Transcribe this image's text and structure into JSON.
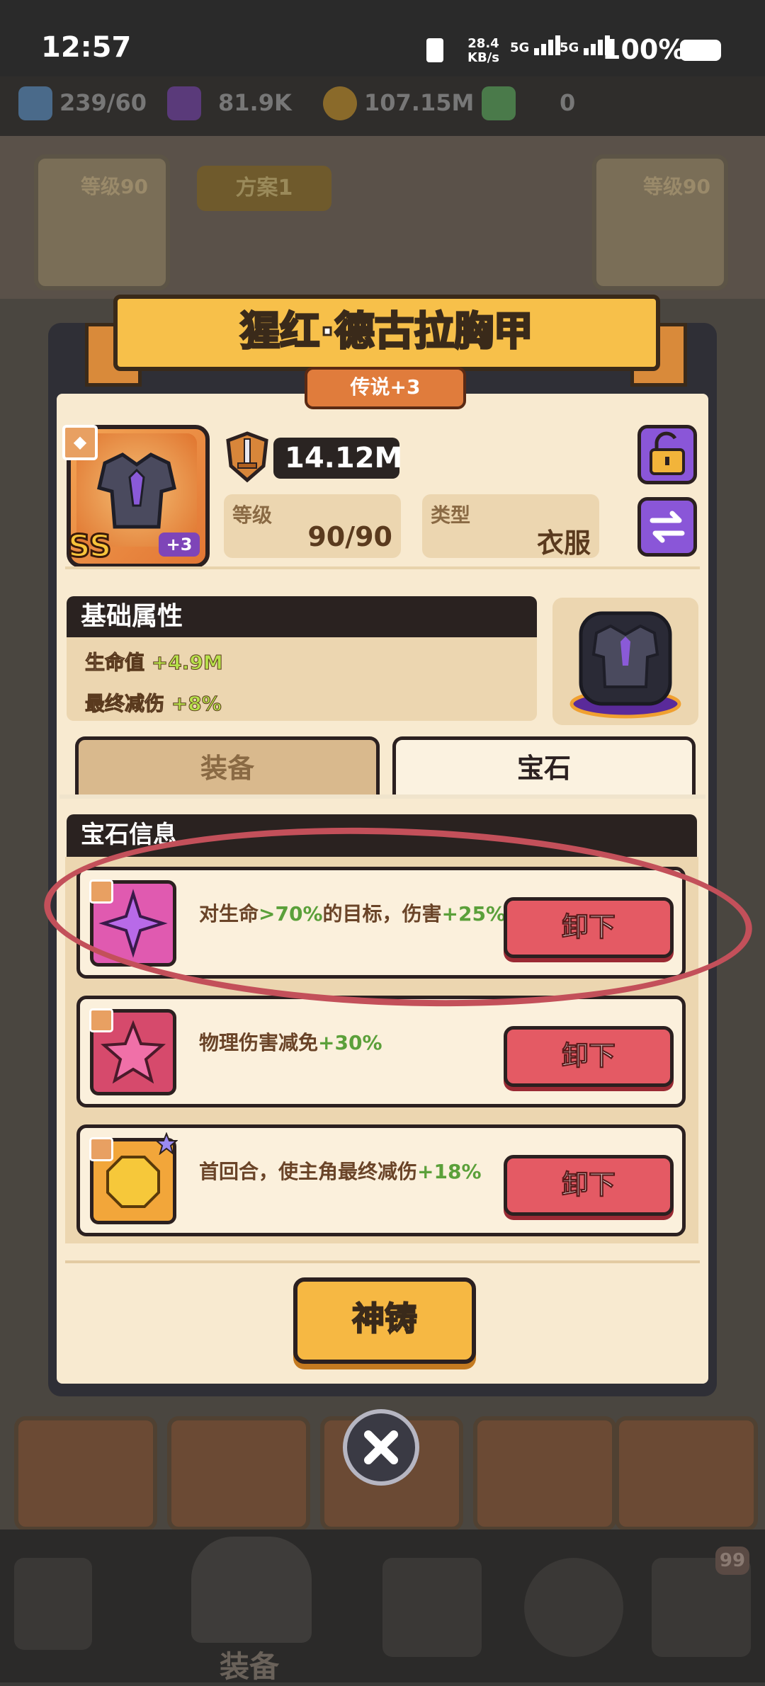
{
  "status_bar": {
    "time": "12:57",
    "net_speed": "28.4",
    "net_unit": "KB/s",
    "sim1": "5G",
    "sim2": "5G",
    "battery": "100%"
  },
  "resources": [
    {
      "value": "239/60",
      "icon": "energy-icon"
    },
    {
      "value": "81.9K",
      "icon": "cube-icon"
    },
    {
      "value": "107.15M",
      "icon": "coin-icon"
    },
    {
      "value": "0",
      "icon": "gem-icon"
    }
  ],
  "background": {
    "plan_label": "方案1",
    "level_left": "等级90",
    "level_right": "等级90",
    "nav_label": "装备",
    "nav_badge": "99"
  },
  "dialog": {
    "title": "猩红·德古拉胸甲",
    "rarity": "传说+3",
    "item": {
      "grade": "SS",
      "plus": "+3"
    },
    "power": "14.12M",
    "level_label": "等级",
    "level_value": "90/90",
    "type_label": "类型",
    "type_value": "衣服",
    "base_attr_title": "基础属性",
    "attrs": [
      {
        "name": "生命值",
        "value": "+4.9M"
      },
      {
        "name": "最终减伤",
        "value": "+8%"
      }
    ],
    "tabs": [
      {
        "label": "装备",
        "active": false
      },
      {
        "label": "宝石",
        "active": true
      }
    ],
    "gem_info_title": "宝石信息",
    "gems": [
      {
        "text_a": "对生命",
        "hl_a": ">70%",
        "text_b": "的目标，伤害",
        "hl_b": "+25%",
        "button": "卸下",
        "color": "#e05ab0",
        "icon": "diamond-star-gem-icon"
      },
      {
        "text_a": "物理伤害减免",
        "hl_a": "+30%",
        "text_b": "",
        "hl_b": "",
        "button": "卸下",
        "color": "#d64a6c",
        "icon": "star-gem-icon"
      },
      {
        "text_a": "首回合，使主角最终减伤",
        "hl_a": "+18%",
        "text_b": "",
        "hl_b": "",
        "button": "卸下",
        "color": "#f2a63a",
        "icon": "octagon-gem-icon"
      }
    ],
    "forge_button": "神铸"
  },
  "colors": {
    "accent_green": "#5ba03a",
    "button_red": "#e45a64",
    "button_gold": "#f6b843",
    "annotation": "#c3505a"
  }
}
